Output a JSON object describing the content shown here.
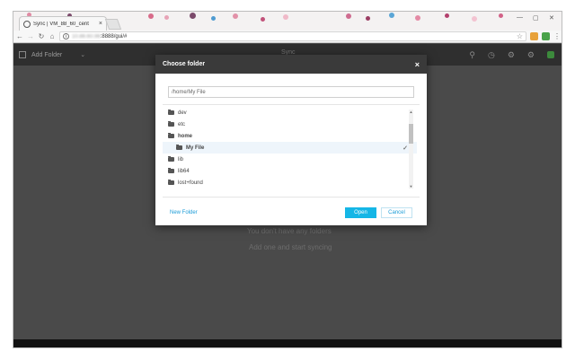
{
  "browser": {
    "tab_title": "Sync | VM_88_60_cent",
    "tab_close": "×",
    "url_host": "10.88.60.98",
    "url": ":8888/gui/#",
    "window_minimize": "—",
    "window_maximize": "▢",
    "window_close": "✕"
  },
  "app": {
    "add_folder_label": "Add Folder",
    "logo_text": "Sync",
    "empty_line1": "You don't have any folders",
    "empty_line2": "Add one and start syncing"
  },
  "dialog": {
    "title": "Choose folder",
    "close": "×",
    "path_value": "/home/My File",
    "folders": [
      {
        "name": "dev"
      },
      {
        "name": "etc"
      },
      {
        "name": "home"
      },
      {
        "name": "My File"
      },
      {
        "name": "lib"
      },
      {
        "name": "lib64"
      },
      {
        "name": "lost+found"
      }
    ],
    "new_folder_label": "New Folder",
    "open_label": "Open",
    "cancel_label": "Cancel"
  },
  "colors": {
    "accent": "#15b6e6",
    "link": "#1a9bd7",
    "dialog_header": "#3a3a3a",
    "app_bg": "#4a4a4a"
  }
}
